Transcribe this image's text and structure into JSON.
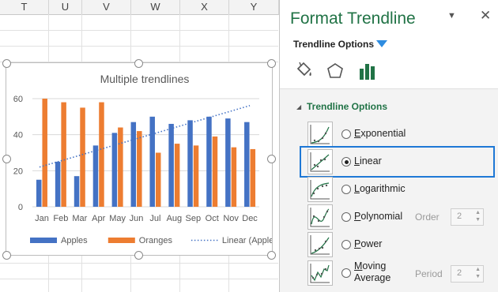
{
  "sheet": {
    "columns": [
      "T",
      "U",
      "V",
      "W",
      "X",
      "Y"
    ]
  },
  "chart": {
    "chart_data": {
      "type": "bar",
      "title": "Multiple  trendlines",
      "categories": [
        "Jan",
        "Feb",
        "Mar",
        "Apr",
        "May",
        "Jun",
        "Jul",
        "Aug",
        "Sep",
        "Oct",
        "Nov",
        "Dec"
      ],
      "series": [
        {
          "name": "Apples",
          "values": [
            15,
            25,
            17,
            34,
            41,
            47,
            50,
            46,
            48,
            50,
            49,
            47
          ],
          "color": "#4472c4"
        },
        {
          "name": "Oranges",
          "values": [
            60,
            58,
            55,
            58,
            44,
            42,
            30,
            35,
            34,
            39,
            33,
            32
          ],
          "color": "#ed7d31"
        }
      ],
      "trendline": {
        "name": "Linear (Apples)",
        "type": "linear",
        "series": "Apples",
        "color": "#4472c4",
        "style": "dotted"
      },
      "yticks": [
        "0",
        "20",
        "40",
        "60"
      ],
      "ylim": [
        0,
        60
      ],
      "legend_position": "bottom",
      "grid": true
    }
  },
  "panel": {
    "title": "Format Trendline",
    "dropdown_icon": "triangle-down-icon",
    "close_icon": "close-icon",
    "section_label": "Trendline Options",
    "tabs": [
      {
        "icon": "paint-bucket-icon",
        "label": "Fill & Line"
      },
      {
        "icon": "pentagon-icon",
        "label": "Effects"
      },
      {
        "icon": "bar-chart-icon",
        "label": "Trendline Options",
        "selected": true
      }
    ],
    "group_label": "Trendline Options",
    "options": [
      {
        "label": "Exponential",
        "checked": false
      },
      {
        "label": "Linear",
        "checked": true
      },
      {
        "label": "Logarithmic",
        "checked": false
      },
      {
        "label": "Polynomial",
        "checked": false,
        "side_label": "Order",
        "side_value": "2"
      },
      {
        "label": "Power",
        "checked": false
      },
      {
        "label": "Moving Average",
        "label_line1": "Moving",
        "label_line2": "Average",
        "checked": false,
        "side_label": "Period",
        "side_value": "2"
      }
    ],
    "accent_color": "#217346",
    "highlight_color": "#1e78d6"
  }
}
